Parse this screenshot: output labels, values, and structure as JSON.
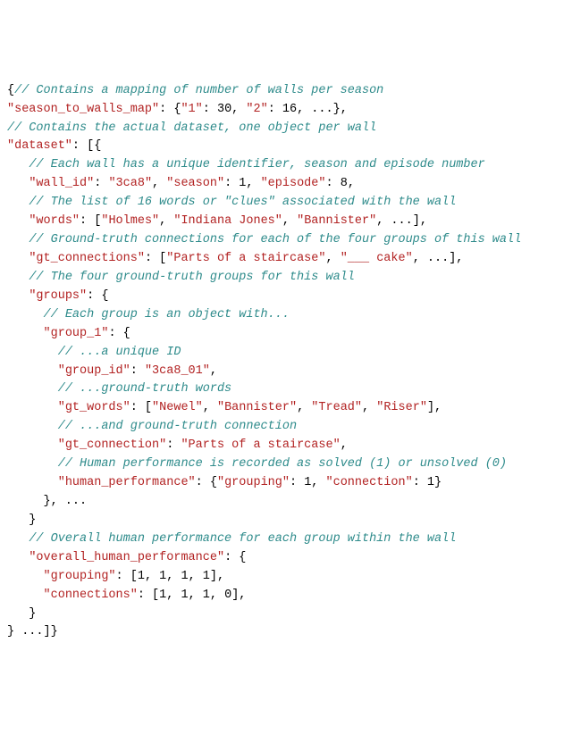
{
  "lines": [
    [
      [
        "p",
        "{"
      ],
      [
        "c",
        "// Contains a mapping of number of walls per season"
      ]
    ],
    [
      [
        "k",
        "\"season_to_walls_map\""
      ],
      [
        "p",
        ": {"
      ],
      [
        "k",
        "\"1\""
      ],
      [
        "p",
        ": "
      ],
      [
        "n",
        "30"
      ],
      [
        "p",
        ", "
      ],
      [
        "k",
        "\"2\""
      ],
      [
        "p",
        ": "
      ],
      [
        "n",
        "16"
      ],
      [
        "p",
        ", ...},"
      ]
    ],
    [
      [
        "c",
        "// Contains the actual dataset, one object per wall"
      ]
    ],
    [
      [
        "k",
        "\"dataset\""
      ],
      [
        "p",
        ": [{"
      ]
    ],
    [
      [
        "p",
        "   "
      ],
      [
        "c",
        "// Each wall has a unique identifier, season and episode number"
      ]
    ],
    [
      [
        "p",
        "   "
      ],
      [
        "k",
        "\"wall_id\""
      ],
      [
        "p",
        ": "
      ],
      [
        "s",
        "\"3ca8\""
      ],
      [
        "p",
        ", "
      ],
      [
        "k",
        "\"season\""
      ],
      [
        "p",
        ": "
      ],
      [
        "n",
        "1"
      ],
      [
        "p",
        ", "
      ],
      [
        "k",
        "\"episode\""
      ],
      [
        "p",
        ": "
      ],
      [
        "n",
        "8"
      ],
      [
        "p",
        ","
      ]
    ],
    [
      [
        "p",
        "   "
      ],
      [
        "c",
        "// The list of 16 words or \"clues\" associated with the wall"
      ]
    ],
    [
      [
        "p",
        "   "
      ],
      [
        "k",
        "\"words\""
      ],
      [
        "p",
        ": ["
      ],
      [
        "s",
        "\"Holmes\""
      ],
      [
        "p",
        ", "
      ],
      [
        "s",
        "\"Indiana Jones\""
      ],
      [
        "p",
        ", "
      ],
      [
        "s",
        "\"Bannister\""
      ],
      [
        "p",
        ", ...],"
      ]
    ],
    [
      [
        "p",
        "   "
      ],
      [
        "c",
        "// Ground-truth connections for each of the four groups of this wall"
      ]
    ],
    [
      [
        "p",
        "   "
      ],
      [
        "k",
        "\"gt_connections\""
      ],
      [
        "p",
        ": ["
      ],
      [
        "s",
        "\"Parts of a staircase\""
      ],
      [
        "p",
        ", "
      ],
      [
        "s",
        "\"___ cake\""
      ],
      [
        "p",
        ", ...],"
      ]
    ],
    [
      [
        "p",
        "   "
      ],
      [
        "c",
        "// The four ground-truth groups for this wall"
      ]
    ],
    [
      [
        "p",
        "   "
      ],
      [
        "k",
        "\"groups\""
      ],
      [
        "p",
        ": {"
      ]
    ],
    [
      [
        "p",
        "     "
      ],
      [
        "c",
        "// Each group is an object with..."
      ]
    ],
    [
      [
        "p",
        "     "
      ],
      [
        "k",
        "\"group_1\""
      ],
      [
        "p",
        ": {"
      ]
    ],
    [
      [
        "p",
        "       "
      ],
      [
        "c",
        "// ...a unique ID"
      ]
    ],
    [
      [
        "p",
        "       "
      ],
      [
        "k",
        "\"group_id\""
      ],
      [
        "p",
        ": "
      ],
      [
        "s",
        "\"3ca8_01\""
      ],
      [
        "p",
        ","
      ]
    ],
    [
      [
        "p",
        "       "
      ],
      [
        "c",
        "// ...ground-truth words"
      ]
    ],
    [
      [
        "p",
        "       "
      ],
      [
        "k",
        "\"gt_words\""
      ],
      [
        "p",
        ": ["
      ],
      [
        "s",
        "\"Newel\""
      ],
      [
        "p",
        ", "
      ],
      [
        "s",
        "\"Bannister\""
      ],
      [
        "p",
        ", "
      ],
      [
        "s",
        "\"Tread\""
      ],
      [
        "p",
        ", "
      ],
      [
        "s",
        "\"Riser\""
      ],
      [
        "p",
        "],"
      ]
    ],
    [
      [
        "p",
        "       "
      ],
      [
        "c",
        "// ...and ground-truth connection"
      ]
    ],
    [
      [
        "p",
        "       "
      ],
      [
        "k",
        "\"gt_connection\""
      ],
      [
        "p",
        ": "
      ],
      [
        "s",
        "\"Parts of a staircase\""
      ],
      [
        "p",
        ","
      ]
    ],
    [
      [
        "p",
        "       "
      ],
      [
        "c",
        "// Human performance is recorded as solved (1) or unsolved (0)"
      ]
    ],
    [
      [
        "p",
        "       "
      ],
      [
        "k",
        "\"human_performance\""
      ],
      [
        "p",
        ": {"
      ],
      [
        "k",
        "\"grouping\""
      ],
      [
        "p",
        ": "
      ],
      [
        "n",
        "1"
      ],
      [
        "p",
        ", "
      ],
      [
        "k",
        "\"connection\""
      ],
      [
        "p",
        ": "
      ],
      [
        "n",
        "1"
      ],
      [
        "p",
        "}"
      ]
    ],
    [
      [
        "p",
        "     }, ..."
      ]
    ],
    [
      [
        "p",
        "   }"
      ]
    ],
    [
      [
        "p",
        "   "
      ],
      [
        "c",
        "// Overall human performance for each group within the wall"
      ]
    ],
    [
      [
        "p",
        "   "
      ],
      [
        "k",
        "\"overall_human_performance\""
      ],
      [
        "p",
        ": {"
      ]
    ],
    [
      [
        "p",
        "     "
      ],
      [
        "k",
        "\"grouping\""
      ],
      [
        "p",
        ": ["
      ],
      [
        "n",
        "1"
      ],
      [
        "p",
        ", "
      ],
      [
        "n",
        "1"
      ],
      [
        "p",
        ", "
      ],
      [
        "n",
        "1"
      ],
      [
        "p",
        ", "
      ],
      [
        "n",
        "1"
      ],
      [
        "p",
        "],"
      ]
    ],
    [
      [
        "p",
        "     "
      ],
      [
        "k",
        "\"connections\""
      ],
      [
        "p",
        ": ["
      ],
      [
        "n",
        "1"
      ],
      [
        "p",
        ", "
      ],
      [
        "n",
        "1"
      ],
      [
        "p",
        ", "
      ],
      [
        "n",
        "1"
      ],
      [
        "p",
        ", "
      ],
      [
        "n",
        "0"
      ],
      [
        "p",
        "],"
      ]
    ],
    [
      [
        "p",
        "   }"
      ]
    ],
    [
      [
        "p",
        "} ...]}"
      ]
    ]
  ]
}
